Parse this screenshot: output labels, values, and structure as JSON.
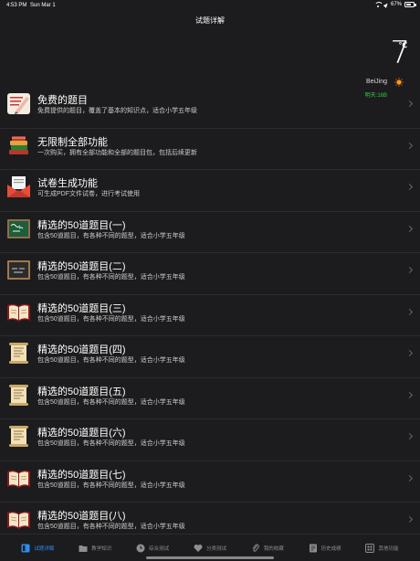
{
  "status": {
    "time": "4:53 PM",
    "date": "Sun Mar 1",
    "battery": "67%",
    "battery_level": 0.67
  },
  "nav": {
    "title": "试题详解"
  },
  "weather": {
    "temp": "7",
    "unit": "℃",
    "city": "BeiJing",
    "forecast": "明天:16B"
  },
  "list": [
    {
      "title": "免费的题目",
      "subtitle": "免费提供的题目，覆盖了基本的知识点，适合小学五年级",
      "icon": "pencil-paper-icon"
    },
    {
      "title": "无限制全部功能",
      "subtitle": "一次购买，拥有全部功能和全部的题目包，包括后续更新",
      "icon": "books-stack-icon"
    },
    {
      "title": "试卷生成功能",
      "subtitle": "可生成PDF文件试卷，进行考试使用",
      "icon": "envelope-icon"
    },
    {
      "title": "精选的50道题目(一)",
      "subtitle": "包含50道题目，有各种不同的题型，适合小学五年级",
      "icon": "chalkboard-green-icon"
    },
    {
      "title": "精选的50道题目(二)",
      "subtitle": "包含50道题目，有各种不同的题型，适合小学五年级",
      "icon": "chalkboard-dark-icon"
    },
    {
      "title": "精选的50道题目(三)",
      "subtitle": "包含50道题目，有各种不同的题型，适合小学五年级",
      "icon": "open-book-icon"
    },
    {
      "title": "精选的50道题目(四)",
      "subtitle": "包含50道题目，有各种不同的题型，适合小学五年级",
      "icon": "scroll-icon"
    },
    {
      "title": "精选的50道题目(五)",
      "subtitle": "包含50道题目，有各种不同的题型，适合小学五年级",
      "icon": "scroll-icon"
    },
    {
      "title": "精选的50道题目(六)",
      "subtitle": "包含50道题目，有各种不同的题型，适合小学五年级",
      "icon": "scroll-icon"
    },
    {
      "title": "精选的50道题目(七)",
      "subtitle": "包含50道题目，有各种不同的题型，适合小学五年级",
      "icon": "open-book-icon"
    },
    {
      "title": "精选的50道题目(八)",
      "subtitle": "包含50道题目，有各种不同的题型，适合小学五年级",
      "icon": "open-book-icon"
    }
  ],
  "tabs": [
    {
      "label": "试题详解",
      "icon": "grid-icon",
      "active": true
    },
    {
      "label": "教学知识",
      "icon": "folder-icon",
      "active": false
    },
    {
      "label": "综合测试",
      "icon": "clock-icon",
      "active": false
    },
    {
      "label": "分类测试",
      "icon": "heart-icon",
      "active": false
    },
    {
      "label": "我的收藏",
      "icon": "paperclip-icon",
      "active": false
    },
    {
      "label": "历史成绩",
      "icon": "history-icon",
      "active": false
    },
    {
      "label": "其他功能",
      "icon": "more-icon",
      "active": false
    }
  ],
  "colors": {
    "accent": "#2d8cf0",
    "forecast": "#2ecc40",
    "background": "#1c1c1e"
  }
}
